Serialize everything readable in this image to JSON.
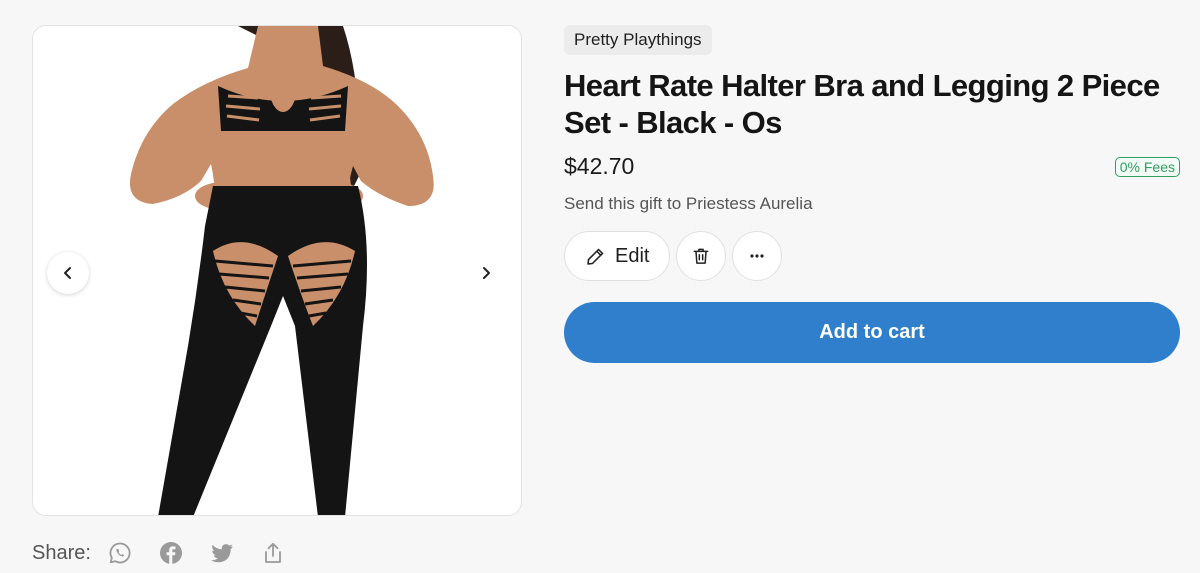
{
  "product": {
    "brand": "Pretty Playthings",
    "title": "Heart Rate Halter Bra and Legging 2 Piece Set - Black - Os",
    "price": "$42.70",
    "fees_badge": "0% Fees",
    "gift_line": "Send this gift to Priestess Aurelia"
  },
  "actions": {
    "edit_label": "Edit",
    "delete_icon": "trash-icon",
    "more_icon": "more-horizontal-icon",
    "add_to_cart_label": "Add to cart"
  },
  "gallery": {
    "prev_icon": "chevron-left-icon",
    "next_icon": "chevron-right-icon"
  },
  "share": {
    "label": "Share:",
    "icons": [
      "whatsapp-icon",
      "facebook-icon",
      "twitter-icon",
      "share-upload-icon"
    ]
  },
  "colors": {
    "accent": "#2f7fcd",
    "fees_green": "#2f9e60",
    "background": "#f7f7f7"
  }
}
